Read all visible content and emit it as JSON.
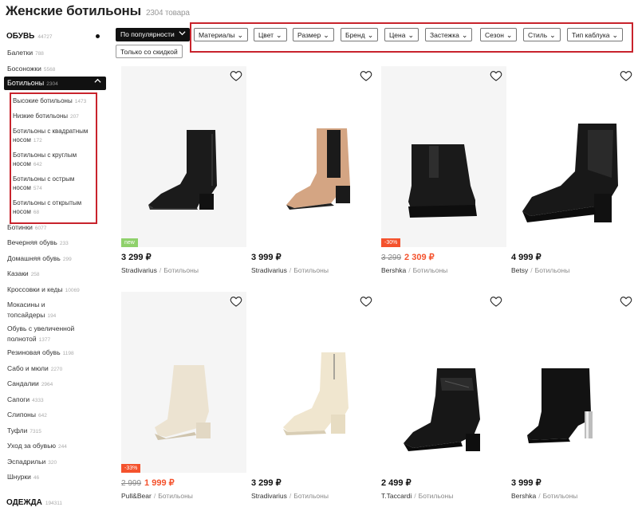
{
  "page": {
    "title": "Женские ботильоны",
    "count": "2304 товара"
  },
  "sidebar": {
    "shoes_header": {
      "label": "ОБУВЬ",
      "count": "44727"
    },
    "items_top": [
      {
        "label": "Балетки",
        "count": "788"
      },
      {
        "label": "Босоножки",
        "count": "5568"
      }
    ],
    "active": {
      "label": "Ботильоны",
      "count": "2304"
    },
    "subitems": [
      {
        "label": "Высокие ботильоны",
        "count": "1473"
      },
      {
        "label": "Низкие ботильоны",
        "count": "207"
      },
      {
        "label": "Ботильоны с квадратным носом",
        "count": "172"
      },
      {
        "label": "Ботильоны с круглым носом",
        "count": "642"
      },
      {
        "label": "Ботильоны с острым носом",
        "count": "574"
      },
      {
        "label": "Ботильоны с открытым носом",
        "count": "68"
      }
    ],
    "items_bottom": [
      {
        "label": "Ботинки",
        "count": "6077"
      },
      {
        "label": "Вечерняя обувь",
        "count": "233"
      },
      {
        "label": "Домашняя обувь",
        "count": "299"
      },
      {
        "label": "Казаки",
        "count": "258"
      },
      {
        "label": "Кроссовки и кеды",
        "count": "10069"
      },
      {
        "label": "Мокасины и топсайдеры",
        "count": "194"
      },
      {
        "label": "Обувь с увеличенной полнотой",
        "count": "1377"
      },
      {
        "label": "Резиновая обувь",
        "count": "1198"
      },
      {
        "label": "Сабо и мюли",
        "count": "2270"
      },
      {
        "label": "Сандалии",
        "count": "2964"
      },
      {
        "label": "Сапоги",
        "count": "4333"
      },
      {
        "label": "Слипоны",
        "count": "642"
      },
      {
        "label": "Туфли",
        "count": "7315"
      },
      {
        "label": "Уход за обувью",
        "count": "244"
      },
      {
        "label": "Эспадрильи",
        "count": "320"
      },
      {
        "label": "Шнурки",
        "count": "46"
      }
    ],
    "clothes_header": {
      "label": "ОДЕЖДА",
      "count": "194311"
    }
  },
  "toolbar": {
    "sort_label": "По популярности",
    "discount_label": "Только со скидкой",
    "filters": [
      "Материалы",
      "Цвет",
      "Размер",
      "Бренд",
      "Цена",
      "Застежка",
      "Сезон",
      "Стиль",
      "Тип каблука"
    ]
  },
  "products": [
    {
      "price": "3 299 ₽",
      "old_price": "",
      "badge": "new",
      "brand": "Stradivarius",
      "type": "Ботильоны",
      "shoe": "black-block"
    },
    {
      "price": "3 999 ₽",
      "old_price": "",
      "badge": "",
      "brand": "Stradivarius",
      "type": "Ботильоны",
      "shoe": "beige-chelsea"
    },
    {
      "price": "2 309 ₽",
      "old_price": "3 299",
      "badge": "-30%",
      "brand": "Bershka",
      "type": "Ботильоны",
      "shoe": "black-platform"
    },
    {
      "price": "4 999 ₽",
      "old_price": "",
      "badge": "",
      "brand": "Betsy",
      "type": "Ботильоны",
      "shoe": "black-chunky"
    },
    {
      "price": "1 999 ₽",
      "old_price": "2 999",
      "badge": "-33%",
      "brand": "Pull&Bear",
      "type": "Ботильоны",
      "shoe": "cream-block"
    },
    {
      "price": "3 299 ₽",
      "old_price": "",
      "badge": "",
      "brand": "Stradivarius",
      "type": "Ботильоны",
      "shoe": "cream-patent"
    },
    {
      "price": "2 499 ₽",
      "old_price": "",
      "badge": "",
      "brand": "T.Taccardi",
      "type": "Ботильоны",
      "shoe": "black-lace"
    },
    {
      "price": "3 999 ₽",
      "old_price": "",
      "badge": "",
      "brand": "Bershka",
      "type": "Ботильоны",
      "shoe": "black-sock"
    }
  ],
  "colors": {
    "accent": "#c8232c",
    "sale": "#f4522d",
    "new": "#8fd16b"
  }
}
